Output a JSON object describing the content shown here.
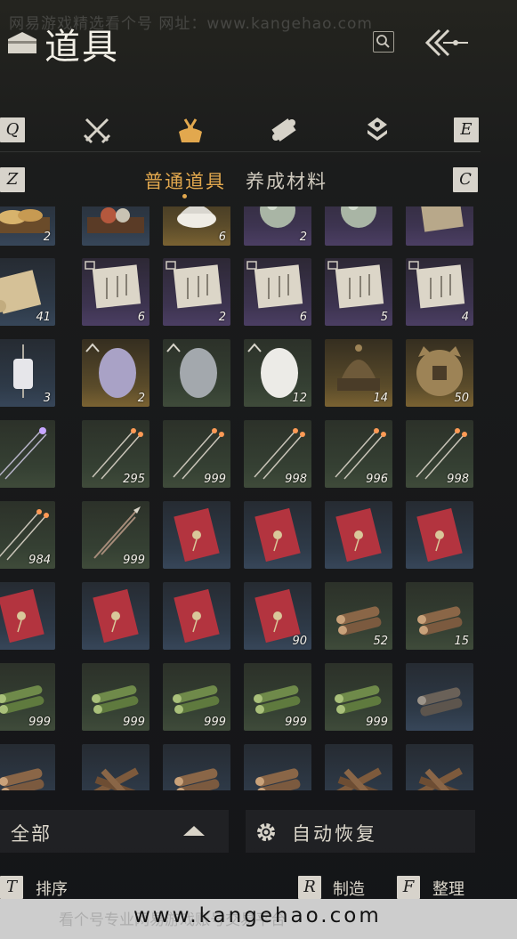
{
  "watermark_top": "网易游戏精选看个号    网址：www.kangehao.com",
  "header": {
    "title": "道具"
  },
  "tabs": {
    "left_key": "Q",
    "right_key": "E",
    "items": [
      {
        "icon": "crossed-swords-icon",
        "active": false
      },
      {
        "icon": "item-bundle-icon",
        "active": true
      },
      {
        "icon": "scroll-icon",
        "active": false
      },
      {
        "icon": "gem-stack-icon",
        "active": false
      }
    ]
  },
  "subtabs": {
    "left_key": "Z",
    "right_key": "C",
    "items": [
      {
        "label": "普通道具",
        "active": true
      },
      {
        "label": "养成材料",
        "active": false
      }
    ]
  },
  "grid": {
    "rows": [
      [
        {
          "item": "bread-tray",
          "quality": "blue",
          "qty": "2"
        },
        {
          "item": "food-tray",
          "quality": "blue",
          "qty": ""
        },
        {
          "item": "white-bowl",
          "quality": "gold",
          "qty": "6"
        },
        {
          "item": "jade-orb",
          "quality": "purple",
          "qty": "2"
        },
        {
          "item": "jade-orb",
          "quality": "purple",
          "qty": ""
        },
        {
          "item": "old-scroll",
          "quality": "purple",
          "qty": ""
        }
      ],
      [
        {
          "item": "paper-scroll",
          "quality": "blue",
          "qty": "41"
        },
        {
          "item": "letter",
          "quality": "purple",
          "qty": "6"
        },
        {
          "item": "letter",
          "quality": "purple",
          "qty": "2"
        },
        {
          "item": "letter",
          "quality": "purple",
          "qty": "6"
        },
        {
          "item": "letter",
          "quality": "purple",
          "qty": "5"
        },
        {
          "item": "letter",
          "quality": "purple",
          "qty": "4"
        }
      ],
      [
        {
          "item": "lantern",
          "quality": "blue",
          "qty": "3"
        },
        {
          "item": "purple-egg",
          "quality": "gold",
          "qty": "2"
        },
        {
          "item": "grey-egg",
          "quality": "green",
          "qty": ""
        },
        {
          "item": "white-egg",
          "quality": "green",
          "qty": "12"
        },
        {
          "item": "bronze-helmet",
          "quality": "gold",
          "qty": "14"
        },
        {
          "item": "bronze-coin",
          "quality": "gold",
          "qty": "50"
        }
      ],
      [
        {
          "item": "violet-arrows",
          "quality": "green",
          "qty": ""
        },
        {
          "item": "fire-arrows",
          "quality": "green",
          "qty": "295"
        },
        {
          "item": "fire-arrows",
          "quality": "green",
          "qty": "999"
        },
        {
          "item": "fire-arrows",
          "quality": "green",
          "qty": "998"
        },
        {
          "item": "fire-arrows",
          "quality": "green",
          "qty": "996"
        },
        {
          "item": "fire-arrows",
          "quality": "green",
          "qty": "998"
        }
      ],
      [
        {
          "item": "fire-arrows",
          "quality": "green",
          "qty": "984"
        },
        {
          "item": "spear-arrows",
          "quality": "green",
          "qty": "999"
        },
        {
          "item": "red-envelope",
          "quality": "blue",
          "qty": ""
        },
        {
          "item": "red-envelope",
          "quality": "blue",
          "qty": ""
        },
        {
          "item": "red-envelope",
          "quality": "blue",
          "qty": ""
        },
        {
          "item": "red-envelope",
          "quality": "blue",
          "qty": ""
        }
      ],
      [
        {
          "item": "red-envelope",
          "quality": "blue",
          "qty": ""
        },
        {
          "item": "red-envelope",
          "quality": "blue",
          "qty": ""
        },
        {
          "item": "red-envelope",
          "quality": "blue",
          "qty": ""
        },
        {
          "item": "red-envelope",
          "quality": "blue",
          "qty": "90"
        },
        {
          "item": "log-bundle",
          "quality": "green",
          "qty": "52"
        },
        {
          "item": "log-bundle",
          "quality": "green",
          "qty": "15"
        }
      ],
      [
        {
          "item": "bamboo-bundle",
          "quality": "green",
          "qty": "999"
        },
        {
          "item": "bamboo-bundle",
          "quality": "green",
          "qty": "999"
        },
        {
          "item": "bamboo-bundle",
          "quality": "green",
          "qty": "999"
        },
        {
          "item": "bamboo-bundle",
          "quality": "green",
          "qty": "999"
        },
        {
          "item": "bamboo-bundle",
          "quality": "green",
          "qty": "999"
        },
        {
          "item": "dark-log-bundle",
          "quality": "blue",
          "qty": ""
        }
      ],
      [
        {
          "item": "log-bundle",
          "quality": "blue",
          "qty": ""
        },
        {
          "item": "firewood",
          "quality": "blue",
          "qty": ""
        },
        {
          "item": "log-bundle",
          "quality": "blue",
          "qty": ""
        },
        {
          "item": "log-bundle",
          "quality": "blue",
          "qty": ""
        },
        {
          "item": "firewood",
          "quality": "blue",
          "qty": ""
        },
        {
          "item": "firewood",
          "quality": "blue",
          "qty": ""
        }
      ]
    ]
  },
  "bottom": {
    "filter_label": "全部",
    "auto_restore_label": "自动恢复"
  },
  "actions": [
    {
      "key": "T",
      "label": "排序"
    },
    {
      "key": "R",
      "label": "制造"
    },
    {
      "key": "F",
      "label": "整理"
    }
  ],
  "footer": {
    "url": "www.kangehao.com",
    "faint_text": "看个号专业网易游戏账号交易平台"
  },
  "colors": {
    "accent": "#e2a84e",
    "key_bg": "#d7d3cb"
  }
}
